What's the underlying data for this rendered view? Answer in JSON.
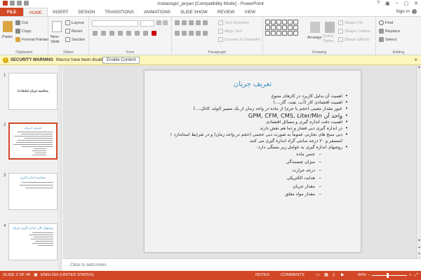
{
  "window": {
    "title": "Andazegiri_jaryan [Compatibility Mode] - PowerPoint",
    "controls": [
      "?",
      "▣",
      "–",
      "▢",
      "✕"
    ]
  },
  "tabs": [
    {
      "label": "FILE"
    },
    {
      "label": "HOME"
    },
    {
      "label": "INSERT"
    },
    {
      "label": "DESIGN"
    },
    {
      "label": "TRANSITIONS"
    },
    {
      "label": "ANIMATIONS"
    },
    {
      "label": "SLIDE SHOW"
    },
    {
      "label": "REVIEW"
    },
    {
      "label": "VIEW"
    }
  ],
  "signin": "Sign in",
  "ribbon": {
    "clipboard": {
      "paste": "Paste",
      "cut": "Cut",
      "copy": "Copy",
      "format_painter": "Format Painter",
      "label": "Clipboard"
    },
    "slides": {
      "new_slide": "New Slide",
      "layout": "Layout",
      "reset": "Reset",
      "section": "Section",
      "label": "Slides"
    },
    "font": {
      "label": "Font"
    },
    "paragraph": {
      "text_direction": "Text Direction",
      "align_text": "Align Text",
      "smartart": "Convert to SmartArt",
      "label": "Paragraph"
    },
    "drawing": {
      "arrange": "Arrange",
      "quick_styles": "Quick Styles",
      "shape_fill": "Shape Fill",
      "shape_outline": "Shape Outline",
      "shape_effects": "Shape Effects",
      "label": "Drawing"
    },
    "editing": {
      "find": "Find",
      "replace": "Replace",
      "select": "Select",
      "label": "Editing"
    }
  },
  "security": {
    "warning": "SECURITY WARNING",
    "message": "Macros have been disabled.",
    "button": "Enable Content"
  },
  "thumbnails": [
    {
      "num": "1",
      "title": "محاسبه جریان (مایعات)"
    },
    {
      "num": "2",
      "title": "تعریف جریان"
    },
    {
      "num": "3",
      "title": "محاسبه اندازه گیری"
    },
    {
      "num": "4",
      "title": "روشهای کلی اندازه گیری جریان"
    }
  ],
  "slide": {
    "title": "تعریف جریان",
    "bullets": [
      {
        "text": "اهمیت آن بدلیل کاربرد در کارهای متنوع",
        "type": "normal"
      },
      {
        "text": "اهمیت اقتصادی کار (آب، نفت، گاز،...)",
        "type": "normal"
      },
      {
        "text": "عبور مقدار معینی (حجم یا جرم) از ماده در واحد زمان از یک مسیر (لوله، کانال،...)",
        "type": "normal"
      },
      {
        "text": "واحد آن GPM, CFM, CMS, Liter/Min",
        "type": "big"
      },
      {
        "text": "اهمیت دقت اندازه گیری و مسائل اقتصادی",
        "type": "normal"
      },
      {
        "text": "در اندازه گیری دبی فشار و دما هم نقش دارند",
        "type": "normal"
      },
      {
        "text": "دبی سنج های تجارتی عموماً به صورت دبی حجمی (حجم در واحد زمان) و در شرایط استاندارد ۱ اتمسفر و ۲۰ درجه سانتی گراد اندازه گیری می کنند",
        "type": "normal"
      },
      {
        "text": "روشهای اندازه گیری به عوامل زیر بستگی دارد:",
        "type": "normal"
      },
      {
        "text": "جنس ماده",
        "type": "sub"
      },
      {
        "text": "میزان چسبندگی",
        "type": "sub"
      },
      {
        "text": "درجه حرارت",
        "type": "sub"
      },
      {
        "text": "هدایت الکتریکی",
        "type": "sub"
      },
      {
        "text": "مقدار جریان",
        "type": "sub"
      },
      {
        "text": "مقدار مواد معلق",
        "type": "sub"
      }
    ]
  },
  "notes": {
    "placeholder": "Click to add notes"
  },
  "status": {
    "slide": "SLIDE 2 OF 45",
    "language": "ENGLISH (UNITED STATES)",
    "notes": "NOTES",
    "comments": "COMMENTS",
    "zoom": "66%"
  },
  "colors": {
    "accent": "#d24726",
    "title": "#3a8dbf",
    "warning_bg": "#fff6bd"
  }
}
